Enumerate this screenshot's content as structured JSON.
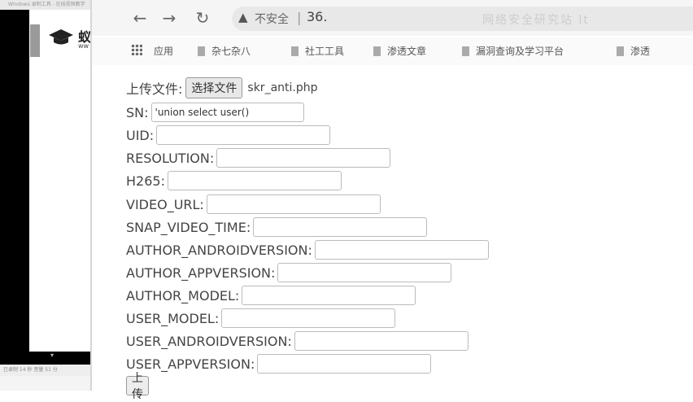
{
  "left_window": {
    "title": "Windows 录制工具 - 在线视频教学",
    "logo_text": "蚁",
    "logo_sub": "ww",
    "status": "已录制 14 秒  音量 51 分"
  },
  "browser": {
    "nav": {
      "back": "←",
      "forward": "→",
      "reload": "↻"
    },
    "address": {
      "insecure_label": "不安全",
      "separator": "|",
      "url": "36."
    },
    "right_blur": "网络安全研究站 lt",
    "bookmarks": [
      {
        "label": "应用"
      },
      {
        "label": "杂七杂八"
      },
      {
        "label": "社工工具"
      },
      {
        "label": "渗透文章"
      },
      {
        "label": "漏洞查询及学习平台"
      },
      {
        "label": "渗透"
      }
    ]
  },
  "form": {
    "file_label": "上传文件:",
    "file_button": "选择文件",
    "file_name": "skr_anti.php",
    "fields": [
      {
        "label": "SN:",
        "value": "'union select user()"
      },
      {
        "label": "UID:",
        "value": ""
      },
      {
        "label": "RESOLUTION:",
        "value": ""
      },
      {
        "label": "H265:",
        "value": ""
      },
      {
        "label": "VIDEO_URL:",
        "value": ""
      },
      {
        "label": "SNAP_VIDEO_TIME:",
        "value": ""
      },
      {
        "label": "AUTHOR_ANDROIDVERSION:",
        "value": ""
      },
      {
        "label": "AUTHOR_APPVERSION:",
        "value": ""
      },
      {
        "label": "AUTHOR_MODEL:",
        "value": ""
      },
      {
        "label": "USER_MODEL:",
        "value": ""
      },
      {
        "label": "USER_ANDROIDVERSION:",
        "value": ""
      },
      {
        "label": "USER_APPVERSION:",
        "value": ""
      }
    ],
    "submit": "上传"
  }
}
